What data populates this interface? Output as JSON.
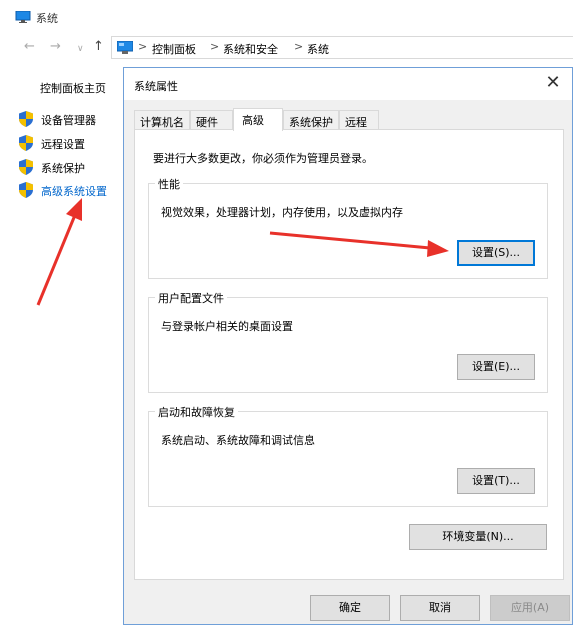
{
  "window": {
    "title": "系统",
    "nav": {
      "back": "←",
      "forward": "→",
      "recent": "∨",
      "up": "↑"
    },
    "breadcrumb": [
      "控制面板",
      "系统和安全",
      "系统"
    ],
    "breadcrumb_sep": ">"
  },
  "sidebar": {
    "home": "控制面板主页",
    "items": [
      {
        "label": "设备管理器",
        "icon": "shield-icon"
      },
      {
        "label": "远程设置",
        "icon": "shield-icon"
      },
      {
        "label": "系统保护",
        "icon": "shield-icon"
      },
      {
        "label": "高级系统设置",
        "icon": "shield-icon"
      }
    ]
  },
  "dialog": {
    "title": "系统属性",
    "close": "✕",
    "tabs": [
      "计算机名",
      "硬件",
      "高级",
      "系统保护",
      "远程"
    ],
    "active_tab": "高级",
    "notice": "要进行大多数更改，你必须作为管理员登录。",
    "groups": [
      {
        "title": "性能",
        "desc": "视觉效果，处理器计划，内存使用，以及虚拟内存",
        "button": "设置(S)..."
      },
      {
        "title": "用户配置文件",
        "desc": "与登录帐户相关的桌面设置",
        "button": "设置(E)..."
      },
      {
        "title": "启动和故障恢复",
        "desc": "系统启动、系统故障和调试信息",
        "button": "设置(T)..."
      }
    ],
    "env_button": "环境变量(N)...",
    "footer": {
      "ok": "确定",
      "cancel": "取消",
      "apply": "应用(A)"
    }
  },
  "colors": {
    "accent": "#0078d7",
    "link": "#0066cc",
    "annotation_arrow": "#e8312a",
    "shield_blue": "#2a6fd1",
    "shield_yellow": "#f4c000"
  }
}
